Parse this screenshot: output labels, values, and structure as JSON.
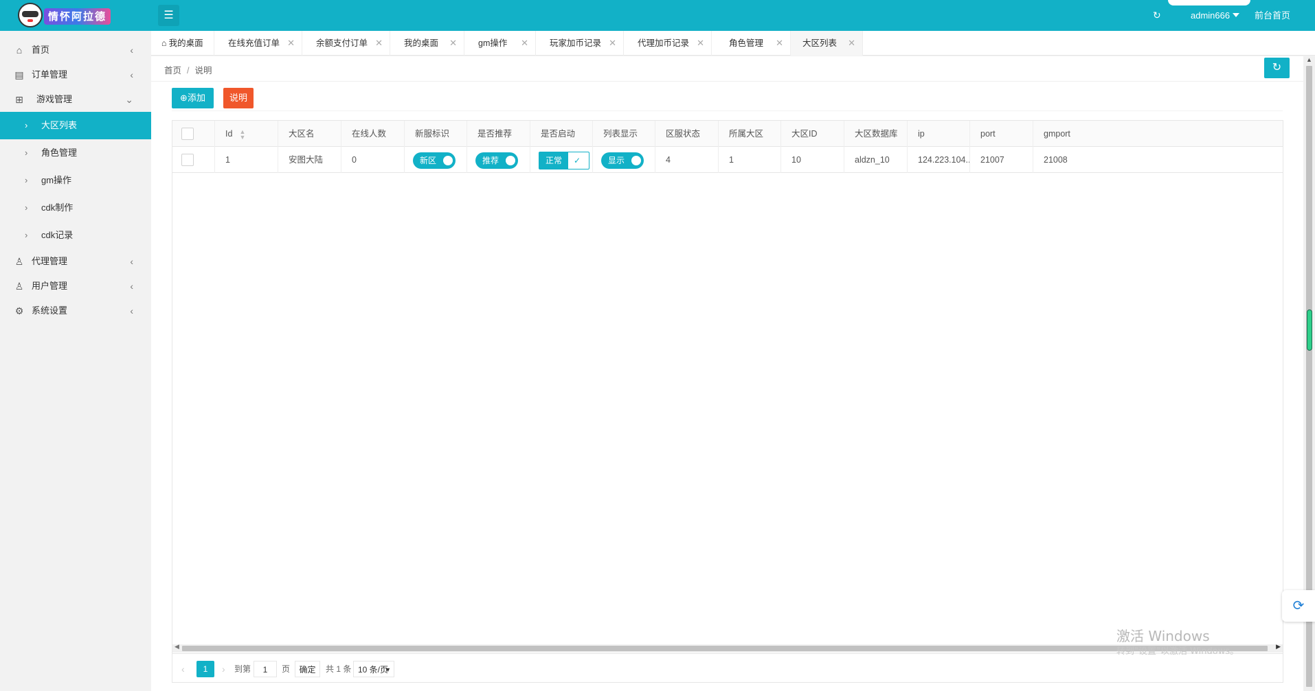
{
  "header": {
    "logo_text": "情怀阿拉德",
    "menu_icon": "hamburger-icon",
    "refresh_icon": "↻",
    "user": "admin666",
    "front_link": "前台首页"
  },
  "sidebar": {
    "items": [
      {
        "label": "首页",
        "icon": "home-icon",
        "glyph": "⌂"
      },
      {
        "label": "订单管理",
        "icon": "document-icon",
        "glyph": "▤"
      },
      {
        "label": "游戏管理",
        "icon": "sitemap-icon",
        "glyph": "⊞"
      },
      {
        "label": "代理管理",
        "icon": "users-icon",
        "glyph": "♙"
      },
      {
        "label": "用户管理",
        "icon": "user-icon",
        "glyph": "♙"
      },
      {
        "label": "系统设置",
        "icon": "gear-icon",
        "glyph": "⚙"
      }
    ],
    "game_sub": [
      {
        "label": "大区列表",
        "active": true
      },
      {
        "label": "角色管理"
      },
      {
        "label": "gm操作"
      },
      {
        "label": "cdk制作"
      },
      {
        "label": "cdk记录"
      }
    ]
  },
  "tabs": [
    {
      "label": "我的桌面",
      "home": true
    },
    {
      "label": "在线充值订单"
    },
    {
      "label": "余额支付订单"
    },
    {
      "label": "我的桌面"
    },
    {
      "label": "gm操作"
    },
    {
      "label": "玩家加币记录"
    },
    {
      "label": "代理加币记录"
    },
    {
      "label": "角色管理"
    },
    {
      "label": "大区列表",
      "active": true
    }
  ],
  "breadcrumb": {
    "home": "首页",
    "sep": "/",
    "current": "说明"
  },
  "toolbar": {
    "add_label": "添加",
    "add_icon": "⊕",
    "help_label": "说明"
  },
  "table": {
    "columns": [
      "Id",
      "大区名",
      "在线人数",
      "新服标识",
      "是否推荐",
      "是否启动",
      "列表显示",
      "区服状态",
      "所属大区",
      "大区ID",
      "大区数据库",
      "ip",
      "port",
      "gmport"
    ],
    "rows": [
      {
        "id": "1",
        "name": "安图大陆",
        "online": "0",
        "new_flag": "新区",
        "recommend": "推荐",
        "enabled": "正常",
        "list_show": "显示",
        "status": "4",
        "parent": "1",
        "zone_id": "10",
        "db": "aldzn_10",
        "ip": "124.223.104...",
        "port": "21007",
        "gmport": "21008"
      }
    ]
  },
  "pager": {
    "current_page": "1",
    "goto_label": "到第",
    "goto_value": "1",
    "page_unit": "页",
    "confirm": "确定",
    "total": "共 1 条",
    "page_size": "10 条/页"
  },
  "watermark": {
    "line1": "激活 Windows",
    "line2": "转到\"设置\"以激活 Windows。"
  },
  "colors": {
    "accent": "#12b1c7",
    "warn": "#f0572b"
  }
}
